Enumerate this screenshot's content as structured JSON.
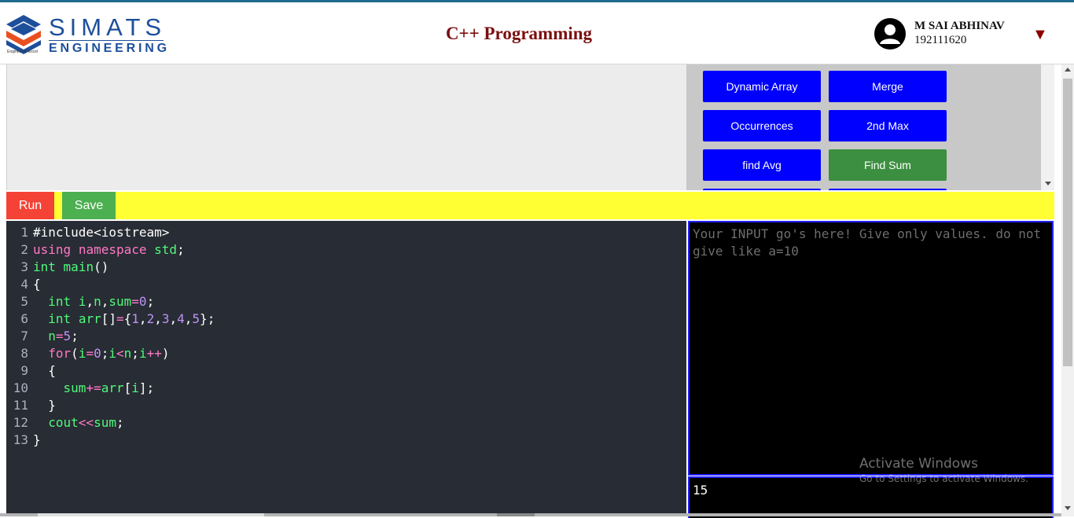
{
  "header": {
    "logo_name": "SIMATS",
    "logo_sub": "ENGINEERING",
    "logo_tagline": "Engineer to Excel",
    "page_title": "C++ Programming",
    "user_name": "M SAI ABHINAV",
    "user_id": "192111620",
    "dropdown_glyph": "▼"
  },
  "problems": [
    {
      "label": "Dynamic Array",
      "state": "default"
    },
    {
      "label": "Merge",
      "state": "default"
    },
    {
      "label": "Occurrences",
      "state": "default"
    },
    {
      "label": "2nd Max",
      "state": "default"
    },
    {
      "label": "find Avg",
      "state": "default"
    },
    {
      "label": "Find Sum",
      "state": "selected"
    }
  ],
  "toolbar": {
    "run_label": "Run",
    "save_label": "Save"
  },
  "code_lines": [
    "#include<iostream>",
    "using namespace std;",
    "int main()",
    "{",
    "  int i,n,sum=0;",
    "  int arr[]={1,2,3,4,5};",
    "  n=5;",
    "  for(i=0;i<n;i++)",
    "  {",
    "    sum+=arr[i];",
    "  }",
    "  cout<<sum;",
    "}"
  ],
  "input": {
    "placeholder": "Your INPUT go's here! Give only values. do not give like a=10"
  },
  "output": {
    "text": "15"
  },
  "watermark": {
    "title": "Activate Windows",
    "subtitle": "Go to Settings to activate Windows."
  },
  "colors": {
    "problem_button": "#0000ff",
    "problem_selected": "#3c8f40",
    "toolbar_bg": "#ffff33",
    "run_button": "#f44336",
    "save_button": "#4caf50",
    "editor_bg": "#282c34",
    "title_color": "#7b1010"
  },
  "icons": {
    "user": "user-avatar-icon",
    "dropdown": "caret-down-icon"
  }
}
